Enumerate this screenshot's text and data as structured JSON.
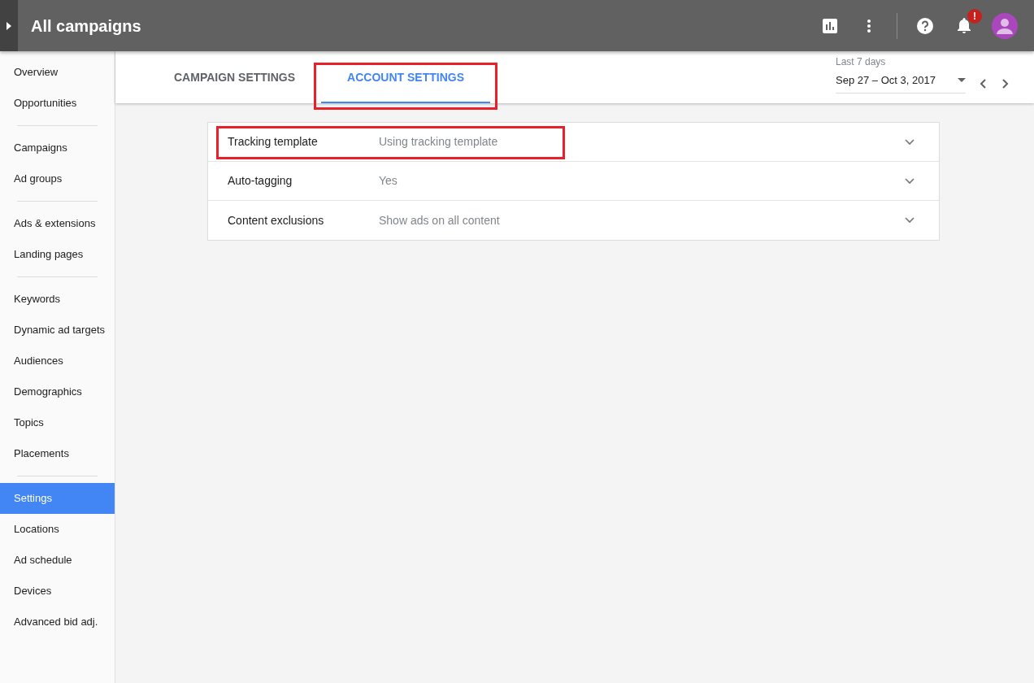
{
  "header": {
    "title": "All campaigns",
    "notification_badge": "!"
  },
  "sidebar": {
    "groups": [
      [
        {
          "label": "Overview",
          "selected": false
        },
        {
          "label": "Opportunities",
          "selected": false
        }
      ],
      [
        {
          "label": "Campaigns",
          "selected": false
        },
        {
          "label": "Ad groups",
          "selected": false
        }
      ],
      [
        {
          "label": "Ads & extensions",
          "selected": false
        },
        {
          "label": "Landing pages",
          "selected": false
        }
      ],
      [
        {
          "label": "Keywords",
          "selected": false
        },
        {
          "label": "Dynamic ad targets",
          "selected": false
        },
        {
          "label": "Audiences",
          "selected": false
        },
        {
          "label": "Demographics",
          "selected": false
        },
        {
          "label": "Topics",
          "selected": false
        },
        {
          "label": "Placements",
          "selected": false
        }
      ],
      [
        {
          "label": "Settings",
          "selected": true
        },
        {
          "label": "Locations",
          "selected": false
        },
        {
          "label": "Ad schedule",
          "selected": false
        },
        {
          "label": "Devices",
          "selected": false
        },
        {
          "label": "Advanced bid adj.",
          "selected": false
        }
      ]
    ]
  },
  "tabs": [
    {
      "label": "CAMPAIGN SETTINGS",
      "selected": false,
      "highlighted": false
    },
    {
      "label": "ACCOUNT SETTINGS",
      "selected": true,
      "highlighted": true
    }
  ],
  "date_range": {
    "label": "Last 7 days",
    "value": "Sep 27 – Oct 3, 2017"
  },
  "settings": [
    {
      "name": "Tracking template",
      "value": "Using tracking template",
      "highlighted": true
    },
    {
      "name": "Auto-tagging",
      "value": "Yes",
      "highlighted": false
    },
    {
      "name": "Content exclusions",
      "value": "Show ads on all content",
      "highlighted": false
    }
  ]
}
